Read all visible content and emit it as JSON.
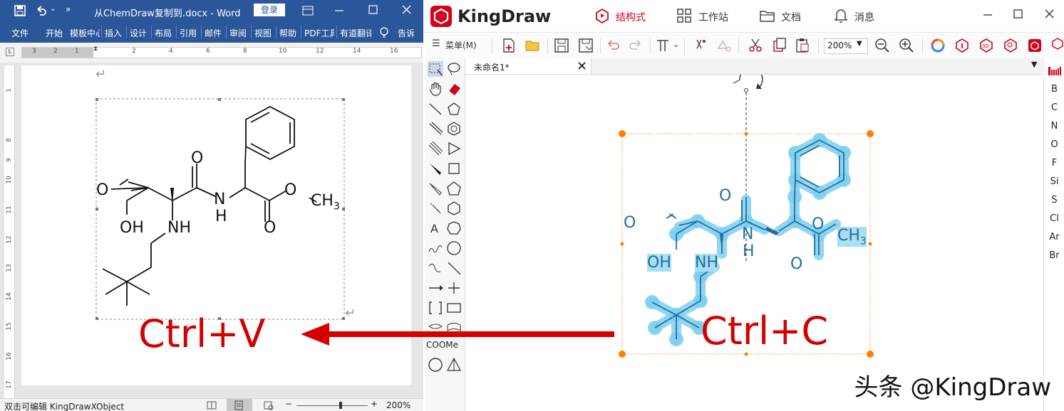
{
  "word": {
    "title": "从ChemDraw复制到.docx - Word",
    "login": "登录",
    "tabs": [
      "文件",
      "开始",
      "模板中心",
      "插入",
      "设计",
      "布局",
      "引用",
      "邮件",
      "审阅",
      "视图",
      "帮助",
      "PDF工具",
      "有道翻译",
      "告诉"
    ],
    "ruler_numbers": [
      "3",
      "2",
      "1",
      "2",
      "4",
      "6",
      "8",
      "10",
      "12",
      "14",
      "16"
    ],
    "vruler_numbers": [
      "1",
      "8",
      "9",
      "10",
      "11",
      "12",
      "13",
      "14",
      "15",
      "16",
      "17"
    ],
    "status_text": "双击可编辑 KingDrawXObject",
    "zoom": "200%"
  },
  "kingdraw": {
    "app_name": "KingDraw",
    "menus": [
      "结构式",
      "工作站",
      "文档",
      "消息"
    ],
    "toolbar_menu": "菜单(M)",
    "zoom_value": "200%",
    "tab_label": "未命名1*",
    "left_labels": {
      "coome": "COOMe",
      "atom": "A"
    },
    "elements": [
      "B",
      "C",
      "N",
      "O",
      "F",
      "Si",
      "S",
      "Cl",
      "Ar",
      "Br"
    ],
    "accent": "#d0021b"
  },
  "overlay": {
    "paste": "Ctrl+V",
    "copy": "Ctrl+C",
    "watermark": "头条 @KingDraw"
  },
  "molecule": {
    "labels": {
      "O": "O",
      "OH": "OH",
      "NH": "NH",
      "N": "N",
      "H": "H",
      "CH": "CH",
      "sub3": "3"
    }
  }
}
